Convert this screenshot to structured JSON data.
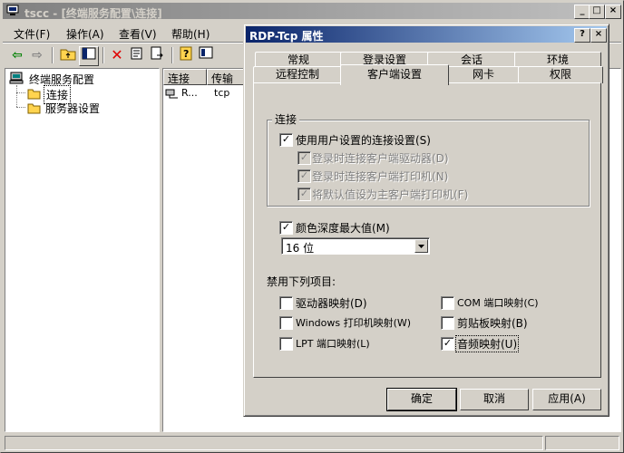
{
  "main_window": {
    "title": "tscc - [终端服务配置\\连接]",
    "menu": [
      "文件(F)",
      "操作(A)",
      "查看(V)",
      "帮助(H)"
    ],
    "tree": {
      "root": "终端服务配置",
      "children": [
        "连接",
        "服务器设置"
      ]
    },
    "list": {
      "columns": [
        "连接",
        "传输"
      ],
      "rows": [
        {
          "name": "R...",
          "transport": "tcp"
        }
      ]
    }
  },
  "dialog": {
    "title": "RDP-Tcp 属性",
    "tabs_row1": [
      "常规",
      "登录设置",
      "会话",
      "环境"
    ],
    "tabs_row2": [
      "远程控制",
      "客户端设置",
      "网卡",
      "权限"
    ],
    "active_tab": "客户端设置",
    "connection_group": {
      "label": "连接",
      "use_user_settings": {
        "label": "使用用户设置的连接设置(S)",
        "checked": true
      },
      "sub_options": [
        {
          "label": "登录时连接客户端驱动器(D)",
          "checked": true,
          "disabled": true
        },
        {
          "label": "登录时连接客户端打印机(N)",
          "checked": true,
          "disabled": true
        },
        {
          "label": "将默认值设为主客户端打印机(F)",
          "checked": true,
          "disabled": true
        }
      ]
    },
    "color_depth": {
      "label": "颜色深度最大值(M)",
      "checked": true,
      "selected": "16 位"
    },
    "disable_label": "禁用下列项目:",
    "disable_items": [
      {
        "label": "驱动器映射(D)",
        "checked": false
      },
      {
        "label": "COM 端口映射(C)",
        "checked": false
      },
      {
        "label": "Windows 打印机映射(W)",
        "checked": false
      },
      {
        "label": "剪贴板映射(B)",
        "checked": false
      },
      {
        "label": "LPT 端口映射(L)",
        "checked": false
      },
      {
        "label": "音频映射(U)",
        "checked": true
      }
    ],
    "buttons": {
      "ok": "确定",
      "cancel": "取消",
      "apply": "应用(A)"
    },
    "help_glyph": "?",
    "close_glyph": "×"
  }
}
